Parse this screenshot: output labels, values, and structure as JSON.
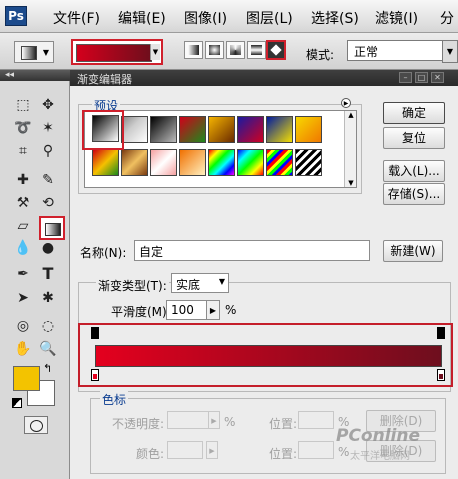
{
  "app": {
    "logo": "Ps",
    "menu": [
      {
        "label": "文件(F)"
      },
      {
        "label": "编辑(E)"
      },
      {
        "label": "图像(I)"
      },
      {
        "label": "图层(L)"
      },
      {
        "label": "选择(S)"
      },
      {
        "label": "滤镜(I)"
      },
      {
        "label": "分"
      }
    ]
  },
  "options_bar": {
    "mode_label": "模式:",
    "mode_value": "正常",
    "gradient_types": [
      "linear",
      "radial",
      "angle",
      "reflected",
      "diamond"
    ],
    "selected_gradient_type": "diamond",
    "gradient_colors": [
      "#d4001c",
      "#6e0e1c"
    ]
  },
  "toolbox": {
    "collapse_glyph": "◂◂",
    "foreground_color": "#f3c300",
    "background_color": "#ffffff",
    "selected_tool": "gradient"
  },
  "dialog": {
    "title": "渐变编辑器",
    "presets_label": "预设",
    "buttons": {
      "ok": "确定",
      "reset": "复位",
      "load": "载入(L)...",
      "save": "存储(S)...",
      "new": "新建(W)",
      "delete": "删除(D)"
    },
    "name_label": "名称(N):",
    "name_value": "自定",
    "gradient_type_label": "渐变类型(T):",
    "gradient_type_value": "实底",
    "smoothness_label": "平滑度(M):",
    "smoothness_value": "100",
    "percent": "%",
    "stops": {
      "group_label": "色标",
      "opacity_label": "不透明度:",
      "color_label": "颜色:",
      "location_label": "位置:"
    },
    "editor_colors": {
      "start": "#e4001e",
      "end": "#6e0e1e"
    }
  },
  "watermark": {
    "text": "PConline",
    "subtext": "太平洋电脑网"
  }
}
